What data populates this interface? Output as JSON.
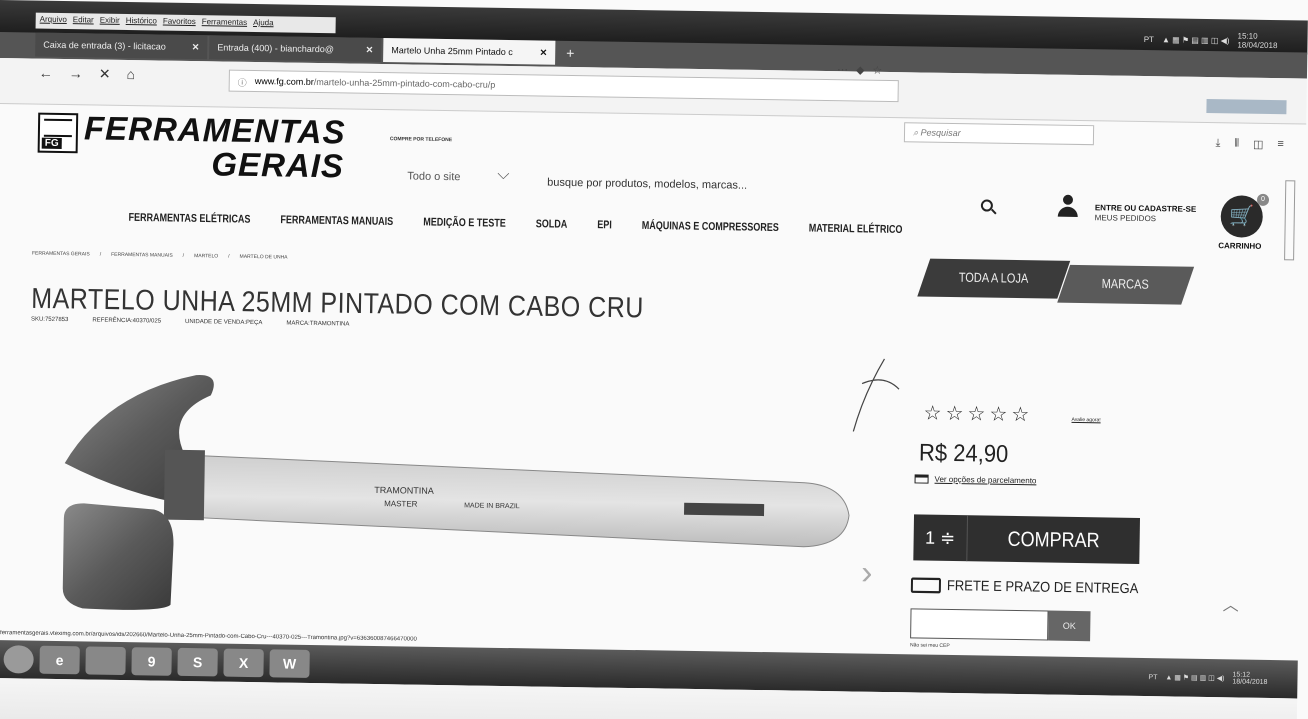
{
  "menubar": [
    "Arquivo",
    "Editar",
    "Exibir",
    "Histórico",
    "Favoritos",
    "Ferramentas",
    "Ajuda"
  ],
  "tray_top": {
    "lang": "PT",
    "time": "15:10",
    "date": "18/04/2018"
  },
  "tabs": [
    {
      "label": "Caixa de entrada (3) - licitacao",
      "active": false
    },
    {
      "label": "Entrada (400) - bianchardo@",
      "active": false
    },
    {
      "label": "Martelo Unha 25mm Pintado c",
      "active": true
    }
  ],
  "url": {
    "host": "www.fg.com.br",
    "path": "/martelo-unha-25mm-pintado-com-cabo-cru/p"
  },
  "browser_search_placeholder": "Pesquisar",
  "site": {
    "logo_line1": "FERRAMENTAS",
    "logo_line2": "GERAIS",
    "logo_badge": "FG",
    "phone_label": "COMPRE POR TELEFONE",
    "scope": "Todo o site",
    "search_placeholder": "busque por produtos, modelos, marcas...",
    "account_title": "ENTRE OU CADASTRE-SE",
    "account_sub": "MEUS PEDIDOS",
    "cart_label": "CARRINHO",
    "cart_count": "0"
  },
  "categories": [
    "FERRAMENTAS ELÉTRICAS",
    "FERRAMENTAS MANUAIS",
    "MEDIÇÃO E TESTE",
    "SOLDA",
    "EPI",
    "MÁQUINAS E COMPRESSORES",
    "MATERIAL ELÉTRICO"
  ],
  "toda_loja": "TODA A LOJA",
  "marcas": "MARCAS",
  "breadcrumb": [
    "FERRAMENTAS GERAIS",
    "/",
    "FERRAMENTAS MANUAIS",
    "/",
    "MARTELO",
    "/",
    "MARTELO DE UNHA"
  ],
  "product": {
    "title": "MARTELO UNHA 25MM PINTADO COM CABO CRU",
    "sku": "SKU:7527853",
    "reference": "REFERÊNCIA:40370/025",
    "unit": "UNIDADE DE VENDA:PEÇA",
    "brand": "MARCA:TRAMONTINA",
    "rating_link": "Avalie agora!",
    "price": "R$ 24,90",
    "installments": "Ver opções de parcelamento",
    "qty": "1 ≑",
    "buy": "COMPRAR",
    "shipping": "FRETE E PRAZO DE ENTREGA",
    "ok": "OK",
    "cep_help": "Não sei meu CEP",
    "handle_text1": "TRAMONTINA",
    "handle_text2": "MASTER",
    "handle_text3": "MADE IN BRAZIL"
  },
  "status_url": "ferramentasgerais.vteximg.com.br/arquivos/ids/202660/Martelo-Unha-25mm-Pintado-com-Cabo-Cru---40370-025---Tramontina.jpg?v=636360087466470000",
  "taskbar_icons": [
    "",
    "e",
    "",
    "9",
    "S",
    "X",
    "W"
  ],
  "tray_bottom": {
    "lang": "PT",
    "time": "15:12",
    "date": "18/04/2018"
  }
}
